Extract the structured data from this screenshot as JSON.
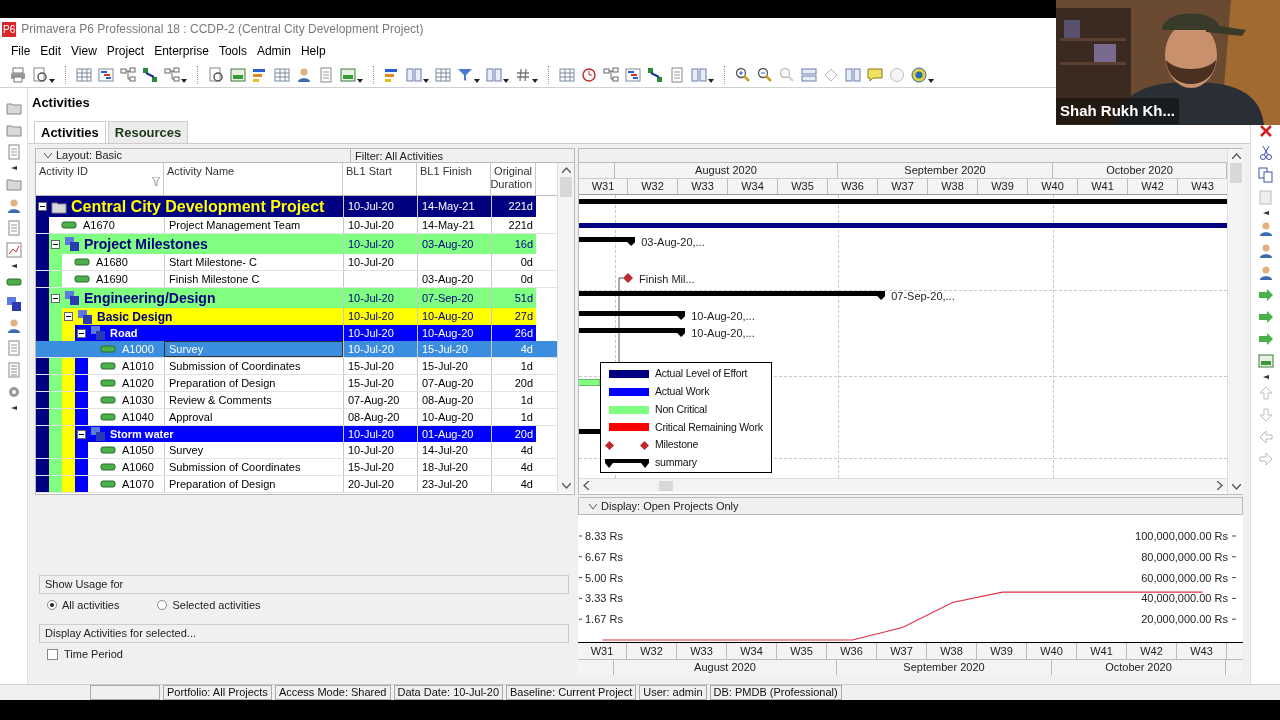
{
  "window": {
    "app_icon": "P6",
    "title": "Primavera P6 Professional 18 : CCDP-2 (Central City Development Project)"
  },
  "menu": [
    "File",
    "Edit",
    "View",
    "Project",
    "Enterprise",
    "Tools",
    "Admin",
    "Help"
  ],
  "workspace": {
    "title": "Activities",
    "tabs": [
      {
        "label": "Activities",
        "selected": true
      },
      {
        "label": "Resources",
        "selected": false
      }
    ]
  },
  "activity_table": {
    "layout": "Layout: Basic",
    "filter": "Filter: All Activities",
    "columns": [
      "Activity ID",
      "Activity Name",
      "BL1 Start",
      "BL1 Finish",
      "Original Duration"
    ],
    "rows": [
      {
        "kind": "wbs",
        "name": "Central City Development Project",
        "start": "10-Jul-20",
        "finish": "14-May-21",
        "duration": "221d",
        "expanded": true,
        "children": [
          {
            "kind": "level_of_effort",
            "id": "A1670",
            "name": "Project Management Team",
            "start": "10-Jul-20",
            "finish": "14-May-21",
            "duration": "221d",
            "selected": false
          },
          {
            "kind": "wbs",
            "name": "Project Milestones",
            "start": "10-Jul-20",
            "finish": "03-Aug-20",
            "duration": "16d",
            "bar_label": "03-Aug-20,...",
            "expanded": true,
            "children": [
              {
                "kind": "start_milestone",
                "id": "A1680",
                "name": "Start Milestone- C",
                "start": "10-Jul-20",
                "duration": "0d",
                "selected": false
              },
              {
                "kind": "finish_milestone",
                "id": "A1690",
                "name": "Finish Milestone C",
                "finish": "03-Aug-20",
                "duration": "0d",
                "bar_label": "Finish Mil...",
                "selected": false
              }
            ]
          },
          {
            "kind": "wbs",
            "name": "Engineering/Design",
            "start": "10-Jul-20",
            "finish": "07-Sep-20",
            "duration": "51d",
            "bar_label": "07-Sep-20,...",
            "expanded": true,
            "children": [
              {
                "kind": "wbs",
                "name": "Basic Design",
                "start": "10-Jul-20",
                "finish": "10-Aug-20",
                "duration": "27d",
                "bar_label": "10-Aug-20,...",
                "expanded": true,
                "children": [
                  {
                    "kind": "wbs",
                    "name": "Road",
                    "start": "10-Jul-20",
                    "finish": "10-Aug-20",
                    "duration": "26d",
                    "bar_label": "10-Aug-20,...",
                    "expanded": true,
                    "children": [
                      {
                        "kind": "task",
                        "id": "A1000",
                        "name": "Survey",
                        "start": "10-Jul-20",
                        "finish": "15-Jul-20",
                        "duration": "4d",
                        "selected": true
                      },
                      {
                        "kind": "task",
                        "id": "A1010",
                        "name": "Submission of Coordinates",
                        "start": "15-Jul-20",
                        "finish": "15-Jul-20",
                        "duration": "1d",
                        "selected": false
                      },
                      {
                        "kind": "task",
                        "id": "A1020",
                        "name": "Preparation of Design",
                        "start": "15-Jul-20",
                        "finish": "07-Aug-20",
                        "duration": "20d",
                        "selected": false
                      },
                      {
                        "kind": "task",
                        "id": "A1030",
                        "name": "Review & Comments",
                        "start": "07-Aug-20",
                        "finish": "08-Aug-20",
                        "duration": "1d",
                        "selected": false
                      },
                      {
                        "kind": "task",
                        "id": "A1040",
                        "name": "Approval",
                        "start": "08-Aug-20",
                        "finish": "10-Aug-20",
                        "duration": "1d",
                        "selected": false
                      }
                    ]
                  },
                  {
                    "kind": "wbs",
                    "name": "Storm water",
                    "start": "10-Jul-20",
                    "finish": "01-Aug-20",
                    "duration": "20d",
                    "expanded": true,
                    "children": [
                      {
                        "kind": "task",
                        "id": "A1050",
                        "name": "Survey",
                        "start": "10-Jul-20",
                        "finish": "14-Jul-20",
                        "duration": "4d",
                        "selected": false
                      },
                      {
                        "kind": "task",
                        "id": "A1060",
                        "name": "Submission of Coordinates",
                        "start": "15-Jul-20",
                        "finish": "18-Jul-20",
                        "duration": "4d",
                        "selected": false
                      },
                      {
                        "kind": "task",
                        "id": "A1070",
                        "name": "Preparation of Design",
                        "start": "20-Jul-20",
                        "finish": "23-Jul-20",
                        "duration": "4d",
                        "selected": false
                      }
                    ]
                  }
                ]
              }
            ]
          }
        ]
      }
    ]
  },
  "gantt": {
    "months": [
      "August 2020",
      "September 2020",
      "October 2020"
    ],
    "weeks": [
      "W31",
      "W32",
      "W33",
      "W34",
      "W35",
      "W36",
      "W37",
      "W38",
      "W39",
      "W40",
      "W41",
      "W42",
      "W43"
    ],
    "legend": [
      {
        "label": "Actual Level of Effort",
        "kind": "bar",
        "color": "#000080"
      },
      {
        "label": "Actual Work",
        "kind": "bar",
        "color": "#0000ff"
      },
      {
        "label": "Non Critical",
        "kind": "bar",
        "color": "#80ff80"
      },
      {
        "label": "Critical Remaining Work",
        "kind": "bar",
        "color": "#ff0000"
      },
      {
        "label": "Milestone",
        "kind": "milestone",
        "color": "#c0282d"
      },
      {
        "label": "summary",
        "kind": "summary",
        "color": "#000000"
      }
    ]
  },
  "usage_panel": {
    "show_usage_for": "Show Usage for",
    "options": [
      {
        "label": "All activities",
        "selected": true
      },
      {
        "label": "Selected activities",
        "selected": false
      }
    ],
    "display_activities_for": "Display Activities for selected...",
    "time_period": {
      "label": "Time Period",
      "checked": false
    }
  },
  "resource_chart": {
    "display": "Display: Open Projects Only",
    "left_axis_labels": [
      "8.33 Rs",
      "6.67 Rs",
      "5.00 Rs",
      "3.33 Rs",
      "1.67 Rs"
    ],
    "chart_data": {
      "type": "line",
      "categories": [
        "W31",
        "W32",
        "W33",
        "W34",
        "W35",
        "W36",
        "W37",
        "W38",
        "W39",
        "W40",
        "W41",
        "W42",
        "W43"
      ],
      "series": [
        {
          "color": "#e03040",
          "values": [
            0,
            0,
            0,
            0,
            0,
            0,
            12000000,
            36000000,
            46000000,
            46000000,
            46000000,
            46000000,
            46000000
          ]
        }
      ],
      "ylim": [
        -38500000,
        137500000
      ],
      "yticks": [
        {
          "value": 100000000,
          "label": "100,000,000.00 Rs"
        },
        {
          "value": 80000000,
          "label": "80,000,000.00 Rs"
        },
        {
          "value": 60000000,
          "label": "60,000,000.00 Rs"
        },
        {
          "value": 40000000,
          "label": "40,000,000.00 Rs"
        },
        {
          "value": 20000000,
          "label": "20,000,000.00 Rs"
        }
      ]
    },
    "months": [
      "August 2020",
      "September 2020",
      "October 2020"
    ]
  },
  "status_bar": [
    "Portfolio: All Projects",
    "Access Mode: Shared",
    "Data Date: 10-Jul-20",
    "Baseline: Current Project",
    "User: admin",
    "DB: PMDB (Professional)"
  ],
  "video_overlay": {
    "participant_name": "Shah Rukh Kh..."
  }
}
